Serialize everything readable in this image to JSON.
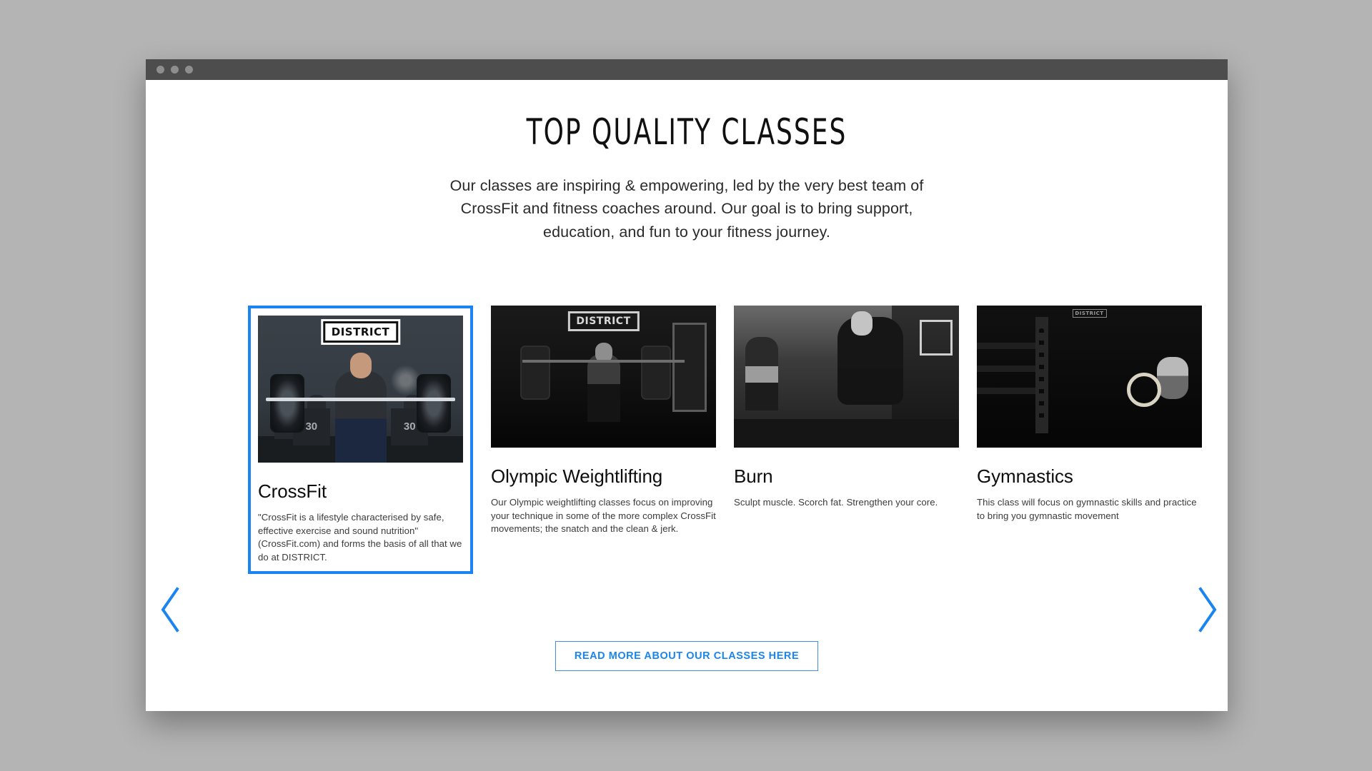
{
  "window": {
    "traffic_lights": [
      "close",
      "minimize",
      "maximize"
    ]
  },
  "section": {
    "heading": "TOP QUALITY CLASSES",
    "subtitle": "Our classes are inspiring & empowering, led by the very best team of CrossFit and fitness coaches around. Our goal is to bring support, education, and fun to your fitness journey."
  },
  "carousel": {
    "prev_label": "Previous",
    "next_label": "Next",
    "active_index": 0,
    "cards": [
      {
        "title": "CrossFit",
        "body": "\"CrossFit is a lifestyle characterised by safe, effective exercise and sound nutrition\" (CrossFit.com) and forms the basis of all that we do at DISTRICT.",
        "image_sign": "DISTRICT",
        "image_alt": "Woman performing a front rack barbell lift in a CrossFit gym"
      },
      {
        "title": "Olympic Weightlifting",
        "body": "Our Olympic weightlifting classes focus on improving your technique in some of the more complex CrossFit movements; the snatch and the clean & jerk.",
        "image_sign": "DISTRICT",
        "image_alt": "Athlete in a front squat position with a barbell"
      },
      {
        "title": "Burn",
        "body": "Sculpt muscle. Scorch fat. Strengthen your core.",
        "image_sign": "",
        "image_alt": "Athlete jumping over a box during a conditioning class"
      },
      {
        "title": "Gymnastics",
        "body": "This class will focus on gymnastic skills and practice to bring you gymnastic movement",
        "image_sign": "DISTRICT",
        "image_alt": "Gymnastics rig with rings and an athlete training"
      }
    ]
  },
  "cta": {
    "label": "READ MORE ABOUT OUR CLASSES HERE"
  },
  "colors": {
    "accent_blue": "#1a85f0",
    "cta_border": "#3d8fe0",
    "titlebar": "#4d4d4d",
    "page_background": "#b4b4b4",
    "heading_text": "#101010",
    "body_text": "#3b3b3b"
  }
}
